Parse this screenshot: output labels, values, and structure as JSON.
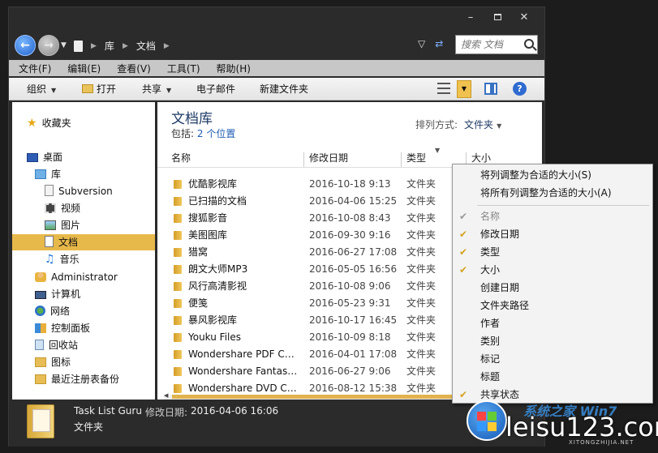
{
  "path": [
    "库",
    "文档"
  ],
  "search": {
    "placeholder": "搜索 文档"
  },
  "menu": [
    "文件(F)",
    "编辑(E)",
    "查看(V)",
    "工具(T)",
    "帮助(H)"
  ],
  "toolbar": {
    "organize": "组织",
    "open": "打开",
    "share": "共享",
    "email": "电子邮件",
    "new_folder": "新建文件夹"
  },
  "nav": [
    {
      "label": "收藏夹",
      "icon": "star-icon"
    },
    {
      "label": "桌面",
      "icon": "desktop-icon"
    },
    {
      "label": "库",
      "icon": "library-icon"
    },
    {
      "label": "Subversion",
      "icon": "subversion-icon"
    },
    {
      "label": "视频",
      "icon": "video-icon"
    },
    {
      "label": "图片",
      "icon": "pictures-icon"
    },
    {
      "label": "文档",
      "icon": "documents-icon",
      "selected": true
    },
    {
      "label": "音乐",
      "icon": "music-icon"
    },
    {
      "label": "Administrator",
      "icon": "user-icon"
    },
    {
      "label": "计算机",
      "icon": "computer-icon"
    },
    {
      "label": "网络",
      "icon": "network-icon"
    },
    {
      "label": "控制面板",
      "icon": "control-panel-icon"
    },
    {
      "label": "回收站",
      "icon": "recycle-bin-icon"
    },
    {
      "label": "图标",
      "icon": "folder-icon"
    },
    {
      "label": "最近注册表备份",
      "icon": "folder-icon"
    }
  ],
  "library": {
    "title": "文档库",
    "sub_label": "包括:",
    "sub_link": "2 个位置",
    "arrange_label": "排列方式:",
    "arrange_value": "文件夹"
  },
  "columns": [
    "名称",
    "修改日期",
    "类型",
    "大小"
  ],
  "files": [
    {
      "name": "优酷影视库",
      "date": "2016-10-18 9:13",
      "type": "文件夹"
    },
    {
      "name": "已扫描的文档",
      "date": "2016-04-06 15:25",
      "type": "文件夹"
    },
    {
      "name": "搜狐影音",
      "date": "2016-10-08 8:43",
      "type": "文件夹"
    },
    {
      "name": "美图图库",
      "date": "2016-09-30 9:16",
      "type": "文件夹"
    },
    {
      "name": "猎窝",
      "date": "2016-06-27 17:08",
      "type": "文件夹"
    },
    {
      "name": "朗文大师MP3",
      "date": "2016-05-05 16:56",
      "type": "文件夹"
    },
    {
      "name": "风行高清影视",
      "date": "2016-10-08 9:06",
      "type": "文件夹"
    },
    {
      "name": "便笺",
      "date": "2016-05-23 9:31",
      "type": "文件夹"
    },
    {
      "name": "暴风影视库",
      "date": "2016-10-17 16:45",
      "type": "文件夹"
    },
    {
      "name": "Youku Files",
      "date": "2016-10-09 8:18",
      "type": "文件夹"
    },
    {
      "name": "Wondershare PDF Conv...",
      "date": "2016-04-01 17:08",
      "type": "文件夹"
    },
    {
      "name": "Wondershare Fantasho...",
      "date": "2016-06-27 9:06",
      "type": "文件夹"
    },
    {
      "name": "Wondershare DVD Crea...",
      "date": "2016-08-12 15:38",
      "type": "文件夹"
    }
  ],
  "details": {
    "name": "Task List Guru",
    "date_label": "修改日期:",
    "date": "2016-04-06 16:06",
    "type": "文件夹"
  },
  "context_menu": [
    {
      "label": "将列调整为合适的大小(S)",
      "check": "none"
    },
    {
      "label": "将所有列调整为合适的大小(A)",
      "check": "none"
    },
    {
      "label": "名称",
      "check": "grey",
      "disabled": true
    },
    {
      "label": "修改日期",
      "check": "gold"
    },
    {
      "label": "类型",
      "check": "gold"
    },
    {
      "label": "大小",
      "check": "gold"
    },
    {
      "label": "创建日期",
      "check": "none"
    },
    {
      "label": "文件夹路径",
      "check": "none"
    },
    {
      "label": "作者",
      "check": "none"
    },
    {
      "label": "类别",
      "check": "none"
    },
    {
      "label": "标记",
      "check": "none"
    },
    {
      "label": "标题",
      "check": "none"
    },
    {
      "label": "共享状态",
      "check": "gold"
    }
  ],
  "watermark": {
    "top": "系统之家 Win7",
    "main": "leisu123.com",
    "small": "XITONGZHIJIA.NET"
  },
  "colors": {
    "selection": "#e7b94a",
    "accent": "#f0c14e",
    "chrome": "#2b2b2b"
  }
}
